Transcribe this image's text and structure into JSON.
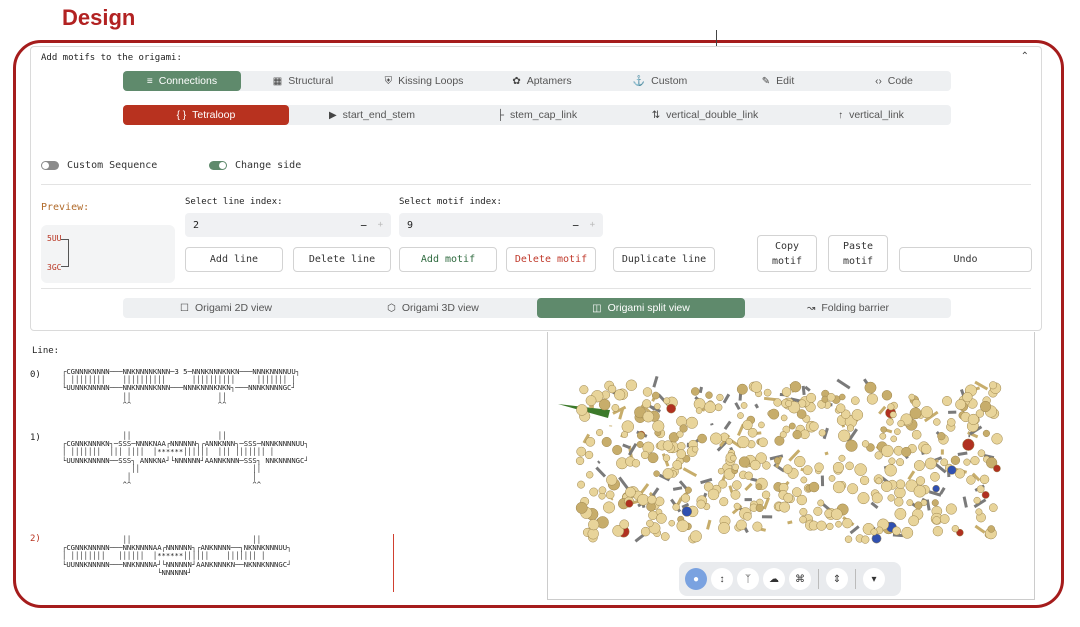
{
  "heading": "Design",
  "panel": {
    "title": "Add motifs to the origami:",
    "collapse_icon": "caret-up-icon",
    "main_tabs": [
      {
        "label": "Connections",
        "icon": "connections-icon",
        "active": true
      },
      {
        "label": "Structural",
        "icon": "grid-icon",
        "active": false
      },
      {
        "label": "Kissing Loops",
        "icon": "shield-icon",
        "active": false
      },
      {
        "label": "Aptamers",
        "icon": "palette-icon",
        "active": false
      },
      {
        "label": "Custom",
        "icon": "anchor-icon",
        "active": false
      },
      {
        "label": "Edit",
        "icon": "pencil-icon",
        "active": false
      },
      {
        "label": "Code",
        "icon": "code-icon",
        "active": false
      }
    ],
    "sub_tabs": [
      {
        "label": "Tetraloop",
        "icon": "braces-icon",
        "active": true
      },
      {
        "label": "start_end_stem",
        "icon": "play-icon",
        "active": false
      },
      {
        "label": "stem_cap_link",
        "icon": "stem-cap-icon",
        "active": false
      },
      {
        "label": "vertical_double_link",
        "icon": "updown-arrows-icon",
        "active": false
      },
      {
        "label": "vertical_link",
        "icon": "up-arrow-icon",
        "active": false
      }
    ],
    "toggles": {
      "custom_sequence": {
        "label": "Custom Sequence",
        "on": false
      },
      "change_side": {
        "label": "Change side",
        "on": true
      }
    },
    "preview": {
      "label": "Preview:",
      "top_text": "5UU",
      "bottom_text": "3GC"
    },
    "line_index": {
      "label": "Select line index:",
      "value": "2",
      "minus": "−",
      "plus": "+"
    },
    "motif_index": {
      "label": "Select motif index:",
      "value": "9",
      "minus": "−",
      "plus": "+"
    },
    "buttons": {
      "add_line": "Add line",
      "delete_line": "Delete line",
      "add_motif": "Add motif",
      "delete_motif": "Delete motif",
      "duplicate_line": "Duplicate line",
      "copy_motif": "Copy\nmotif",
      "paste_motif": "Paste\nmotif",
      "undo": "Undo"
    },
    "view_tabs": [
      {
        "label": "Origami 2D view",
        "icon": "square-icon",
        "active": false
      },
      {
        "label": "Origami 3D view",
        "icon": "cube-icon",
        "active": false
      },
      {
        "label": "Origami split view",
        "icon": "split-view-icon",
        "active": true
      },
      {
        "label": "Folding barrier",
        "icon": "line-chart-icon",
        "active": false
      }
    ]
  },
  "line_view": {
    "label": "Line:",
    "rows": [
      {
        "index": "0)",
        "selected": false
      },
      {
        "index": "1)",
        "selected": false
      },
      {
        "index": "2)",
        "selected": true
      }
    ],
    "seq_block_0": "┌CGNNNKNNNN───NNKNNNNKNNN─3 5─NNNKNNNKNKN───NNNKNNNNUU┐\n│ ││││││││    ││││││││││      ││││││││││     │││││││ │\n└UUNNKNNNNN───NNKNNNNKNNN───NNNKNNNKNKN┐───NNNKNNNNGC┘\n              ││                    ││\n              ^^                    ^^",
    "seq_block_1": "              ││                    ││\n┌CGNNKNNNKN┐─SSS─NNNKNAA┌NNNNNN┐┌ANNKNNN┐─SSS─NNNKNNNNUU┐\n│ │││││││  │││ ││││  │******││││││  │││ │││││││ │\n└UUNNKNNNNN──SSS┐ ANNKNA┘└NNNNNN┘AANNKNNN─SSS┐ NNKNNNNGC┘\n                ││                          ││\n               │                            │\n              ^^                            ^^",
    "seq_block_2": "              ││                            ││\n┌CGNNKNNNNN───NNKNNNNAA┌NNNNNN┐┌ANKNNNN──┐NKNNKNNNUU┐\n│ ││││││││   ││││││  │******││││││    │││││││ │\n└UUNNKNNNNN───NNKNNNNA┘└NNNNNN┘AANKNNNKN──NKNNKNNNGC┘\n                      └NNNNNN┘"
  },
  "viewer_3d": {
    "toolbar": [
      {
        "icon": "pin-icon",
        "active": true
      },
      {
        "icon": "arrows-vertical-icon",
        "active": false
      },
      {
        "icon": "tree-icon",
        "active": false
      },
      {
        "icon": "cloud-icon",
        "active": false
      },
      {
        "icon": "crop-icon",
        "active": false
      },
      {
        "icon": "expand-vertical-icon",
        "active": false
      },
      {
        "icon": "dropdown-icon",
        "active": false
      }
    ],
    "colors": {
      "bead": "#e8d49a",
      "bead_dark": "#c7ad6b",
      "backbone": "#7a7a7a",
      "accent_red": "#b03020",
      "accent_green": "#3c7a2a",
      "accent_blue": "#3050b0"
    }
  }
}
